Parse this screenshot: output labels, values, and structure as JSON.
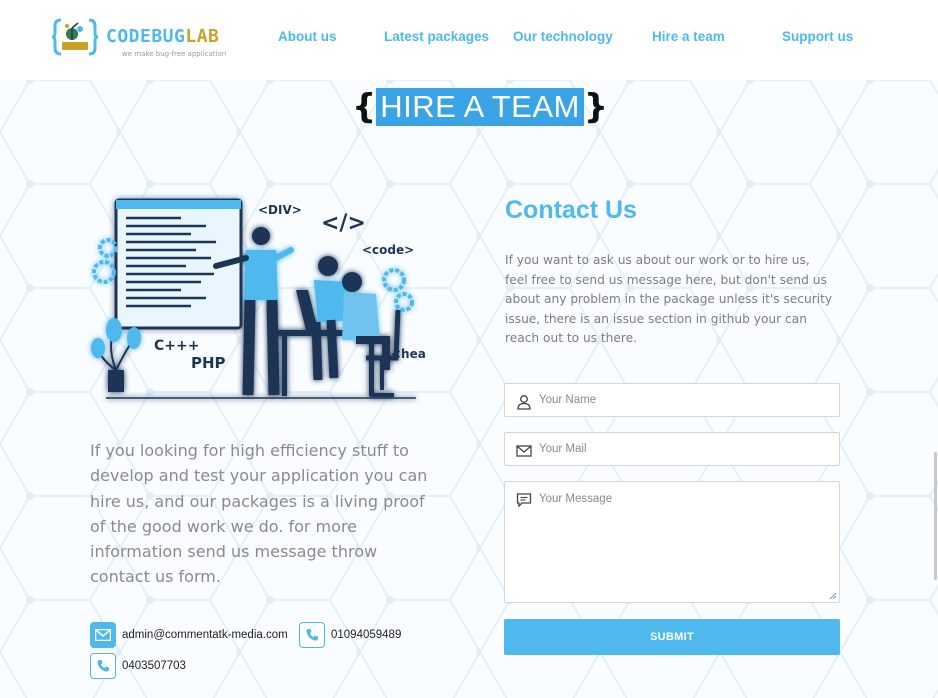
{
  "header": {
    "logo_text_part1": "CODEBUG",
    "logo_text_part2": "LAB",
    "logo_tagline": "we make bug-free application",
    "nav": [
      {
        "label": "About us"
      },
      {
        "label": "Latest packages"
      },
      {
        "label": "Our technology"
      },
      {
        "label": "Hire a team"
      },
      {
        "label": "Support us"
      }
    ]
  },
  "page_title": {
    "brace_open": "{",
    "text": "HIRE A TEAM",
    "brace_close": "}"
  },
  "illustration": {
    "tag_div": "<DIV>",
    "tag_code_sym": "</>",
    "tag_code": "<code>",
    "tag_head": "<head>",
    "lang_cpp": "C+++",
    "lang_php": "PHP"
  },
  "left_text": "If you looking for high efficiency stuff to develop and test your application you can hire us, and our packages is a living proof of the good work we do. for more information send us message throw contact us form.",
  "contacts": {
    "email": "admin@commentatk-media.com",
    "phone1": "01094059489",
    "phone2": "0403507703"
  },
  "contact_form": {
    "title": "Contact Us",
    "description": "If you want to ask us about our work or to hire us, feel free to send us message here, but don't send us about any problem in the package unless it's security issue, there is an issue section in github your can reach out to us there.",
    "name_placeholder": "Your Name",
    "mail_placeholder": "Your Mail",
    "message_placeholder": "Your Message",
    "submit_label": "SUBMIT"
  },
  "colors": {
    "accent": "#4fb8ec",
    "title_highlight": "#3aa3e6",
    "logo_gold": "#c9a227",
    "illustration_navy": "#1d3557"
  },
  "icons": {
    "name_field": "user-icon",
    "mail_field": "envelope-icon",
    "message_field": "chat-bubble-icon",
    "email_chip": "envelope-icon",
    "phone_chip": "phone-icon"
  }
}
